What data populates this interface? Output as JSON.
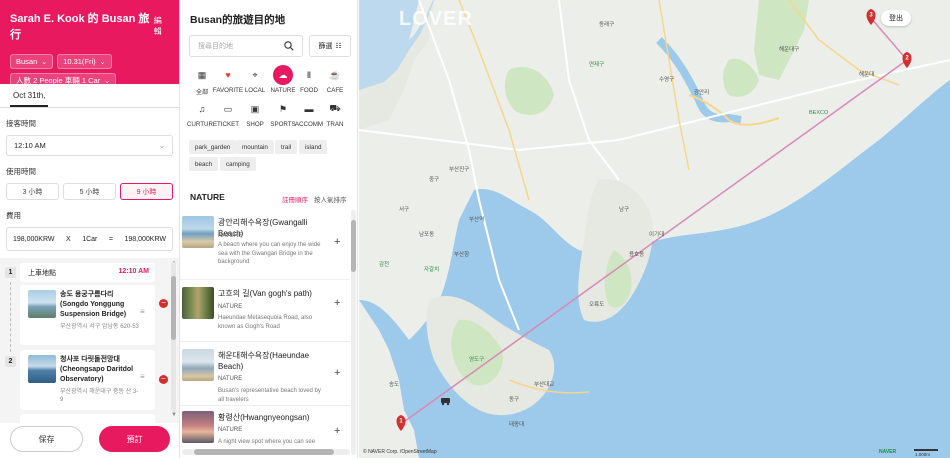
{
  "left": {
    "title": "Sarah E. Kook 的 Busan 旅行",
    "edit_label": "編輯",
    "city": "Busan",
    "date_pill": "10.31(Fri)",
    "people_pill": "人數 2 People 車輛 1 Car",
    "date_tab": "Oct 31th,",
    "pickup_label": "接客時間",
    "pickup_time": "12:10 AM",
    "usage_label": "使用時間",
    "hours": [
      "3 小時",
      "5 小時",
      "9 小時"
    ],
    "selected_hours": "9 小時",
    "fee_label": "費用",
    "fee": {
      "unit_price": "198,000KRW",
      "x": "X",
      "cars": "1Car",
      "eq": "=",
      "total": "198,000KRW"
    },
    "itinerary": {
      "pickup_num": "1",
      "pickup_label": "上車地點",
      "pickup_time": "12:10 AM",
      "stops": [
        {
          "num": "",
          "name": "송도 용궁구름다리 (Songdo Yonggung Suspension Bridge)",
          "address": "부산광역시 서구 암남동 620-53"
        },
        {
          "num": "2",
          "name": "청사포 다릿돌전망대 (Cheongsapo Daritdol Observatory)",
          "address": "부산광역시 해운대구 중동 산 3-9"
        }
      ]
    },
    "save_label": "保存",
    "book_label": "預訂"
  },
  "mid": {
    "title": "Busan的旅遊目的地",
    "search_placeholder": "搜尋目的地",
    "filter_label": "篩選",
    "categories": [
      {
        "label": "全部",
        "icon": "grid-icon"
      },
      {
        "label": "FAVORITE",
        "icon": "heart-icon"
      },
      {
        "label": "LOCAL",
        "icon": "pin-icon"
      },
      {
        "label": "NATURE",
        "icon": "leaf-icon"
      },
      {
        "label": "FOOD",
        "icon": "utensils-icon"
      },
      {
        "label": "CAFE",
        "icon": "cup-icon"
      },
      {
        "label": "CURTURE",
        "icon": "music-icon"
      },
      {
        "label": "TICKET",
        "icon": "ticket-icon"
      },
      {
        "label": "SHOP",
        "icon": "bag-icon"
      },
      {
        "label": "SPORTS",
        "icon": "run-icon"
      },
      {
        "label": "ACCOMM",
        "icon": "bed-icon"
      },
      {
        "label": "TRAN",
        "icon": "car-icon"
      }
    ],
    "selected_category": "NATURE",
    "tags": [
      "park_garden",
      "mountain",
      "trail",
      "island",
      "beach",
      "camping"
    ],
    "section_title": "NATURE",
    "sort_a": "註冊順序",
    "sort_b": "按人氣排序",
    "places": [
      {
        "name": "광안리해수욕장(Gwangalli Beach)",
        "tag": "NATURE",
        "desc": "A beach where you can enjoy the wide sea with the Gwangan Bridge in the background"
      },
      {
        "name": "고흐의 길(Van gogh's path)",
        "tag": "NATURE",
        "desc": "Haeundae Metasequoia Road, also known as Gogh's Road"
      },
      {
        "name": "해운대해수욕장(Haeundae Beach)",
        "tag": "NATURE",
        "desc": "Busan's representative beach loved by all travelers"
      },
      {
        "name": "황령산(Hwangnyeongsan)",
        "tag": "NATURE",
        "desc": "A night view spot where you can see"
      }
    ]
  },
  "map": {
    "logo": "LOVER",
    "exit_label": "登出",
    "marker1": "1",
    "marker2": "2",
    "marker3": "3",
    "attribution": "© NAVER Corp. /OpenStreetMap",
    "naver": "NAVER",
    "scale": "1,000m",
    "labels": [
      "부산진구",
      "수영구",
      "해운대구",
      "연제구",
      "동래구",
      "남구",
      "부산역",
      "광안리",
      "BEXCO",
      "해운대",
      "용호동",
      "이기대",
      "오륙도",
      "영도구",
      "중구",
      "서구",
      "동구",
      "태종대",
      "감천",
      "송도",
      "부산항",
      "부산대교",
      "남포동",
      "자갈치"
    ],
    "route_color": "#d988b9",
    "accent": "#e8195e"
  }
}
